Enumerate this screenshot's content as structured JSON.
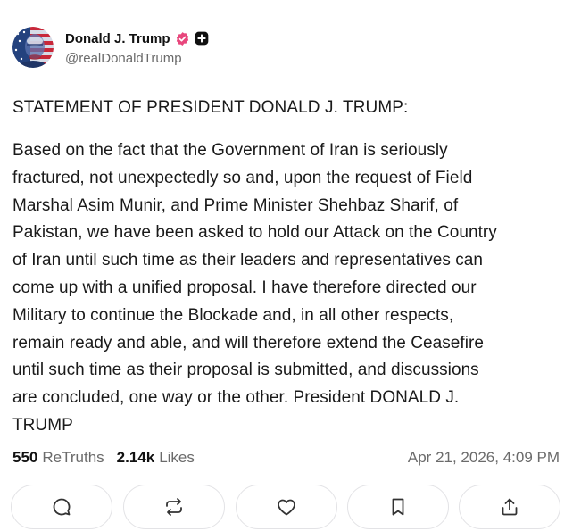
{
  "post": {
    "author_name": "Donald J. Trump",
    "handle": "@realDonaldTrump",
    "heading": "STATEMENT OF PRESIDENT DONALD J. TRUMP:",
    "body_lines": [
      "Based on the fact that the Government of Iran is seriously",
      "fractured, not unexpectedly so and, upon the request of Field",
      "Marshal Asim Munir, and Prime Minister Shehbaz Sharif, of",
      "Pakistan, we have been asked to hold our Attack on the Country",
      "of Iran until such time as their leaders and representatives can",
      "come up with a unified proposal. I have therefore directed our",
      "Military to continue the Blockade and, in all other respects,",
      "remain ready and able, and will therefore extend the Ceasefire",
      "until such time as their proposal is submitted, and discussions",
      "are concluded, one way or the other. President DONALD J.",
      "TRUMP"
    ],
    "retruths_count": "550",
    "retruths_label": "ReTruths",
    "likes_count": "2.14k",
    "likes_label": "Likes",
    "timestamp": "Apr 21, 2026, 4:09 PM"
  },
  "icons": {
    "verified": "verified-badge-icon",
    "plus": "plus-badge-icon",
    "reply": "reply-icon",
    "retruth": "retruth-icon",
    "like": "heart-icon",
    "bookmark": "bookmark-icon",
    "share": "share-icon"
  },
  "colors": {
    "verified": "#e8467c",
    "muted_text": "#6b6b6b",
    "button_border": "#e3e3e6"
  }
}
